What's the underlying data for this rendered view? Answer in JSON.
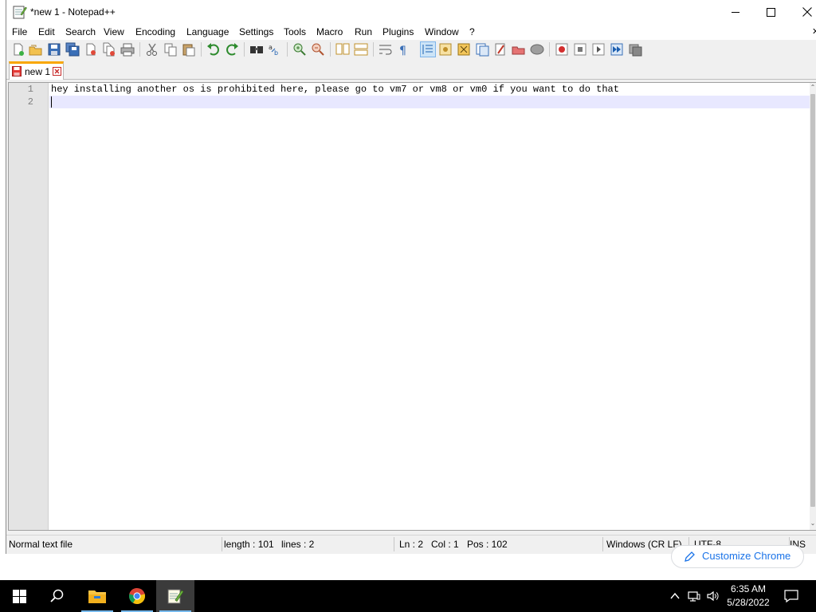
{
  "window": {
    "title": "*new 1 - Notepad++",
    "minimize_icon": "minimize-icon",
    "maximize_icon": "maximize-icon",
    "close_icon": "close-icon"
  },
  "menu": {
    "items": [
      "File",
      "Edit",
      "Search",
      "View",
      "Encoding",
      "Language",
      "Settings",
      "Tools",
      "Macro",
      "Run",
      "Plugins",
      "Window",
      "?"
    ],
    "close_glyph": "✕"
  },
  "tabs": [
    {
      "label": "new 1",
      "unsaved": true
    }
  ],
  "editor": {
    "line_numbers": [
      "1",
      "2"
    ],
    "lines": [
      "hey installing another os is prohibited here, please go to vm7 or vm8 or vm0 if you want to do that",
      ""
    ],
    "current_line_index": 1,
    "scroll_up_glyph": "⌃",
    "scroll_down_glyph": "⌄"
  },
  "status": {
    "file_type": "Normal text file",
    "length": "length : 101",
    "lines": "lines : 2",
    "ln": "Ln : 2",
    "col": "Col : 1",
    "pos": "Pos : 102",
    "eol": "Windows (CR LF)",
    "encoding": "UTF-8",
    "mode": "INS"
  },
  "chrome_overlay": {
    "label": "Customize Chrome"
  },
  "taskbar": {
    "time": "6:35 AM",
    "date": "5/28/2022",
    "pinned": [
      "file-explorer",
      "google-chrome",
      "notepad-plus-plus"
    ]
  },
  "colors": {
    "tab_accent": "#f9a600",
    "current_line": "#e8e8ff",
    "chrome_link": "#1a73e8",
    "taskbar": "#000000",
    "taskbar_active_underline": "#76b9ed"
  }
}
